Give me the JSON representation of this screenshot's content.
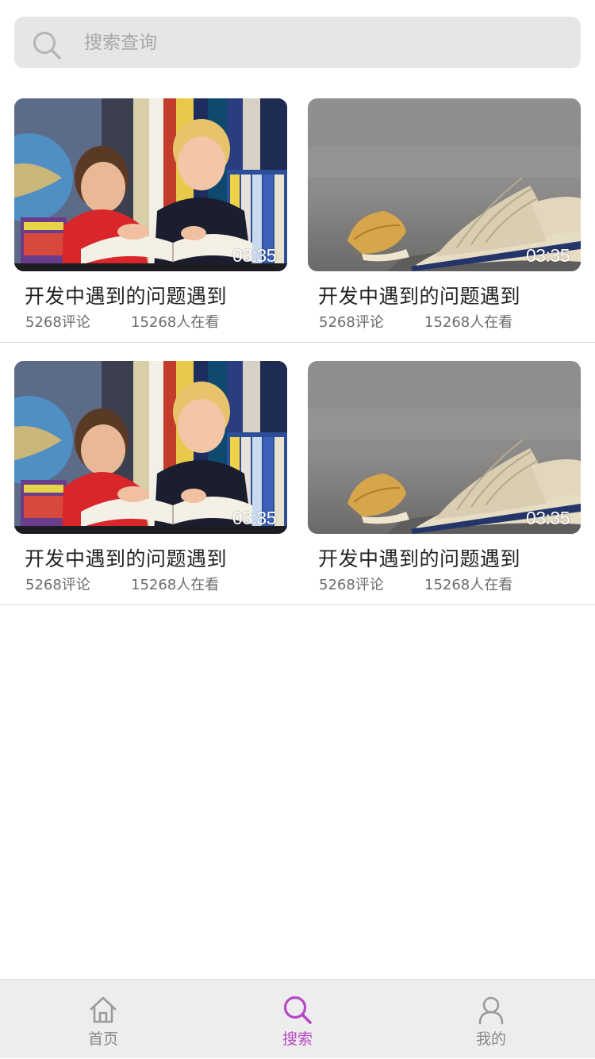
{
  "search": {
    "placeholder": "搜索查询",
    "icon": "search-icon"
  },
  "videos": [
    {
      "thumbnail": "boys-reading-books",
      "duration": "03:35",
      "title": "开发中遇到的问题遇到",
      "comments": "5268评论",
      "viewers": "15268人在看"
    },
    {
      "thumbnail": "open-book-with-leaf",
      "duration": "03:35",
      "title": "开发中遇到的问题遇到",
      "comments": "5268评论",
      "viewers": "15268人在看"
    },
    {
      "thumbnail": "boys-reading-books",
      "duration": "03:35",
      "title": "开发中遇到的问题遇到",
      "comments": "5268评论",
      "viewers": "15268人在看"
    },
    {
      "thumbnail": "open-book-with-leaf",
      "duration": "03:35",
      "title": "开发中遇到的问题遇到",
      "comments": "5268评论",
      "viewers": "15268人在看"
    }
  ],
  "tabbar": {
    "items": [
      {
        "label": "首页",
        "icon": "home-icon",
        "active": false
      },
      {
        "label": "搜索",
        "icon": "search-icon",
        "active": true
      },
      {
        "label": "我的",
        "icon": "user-icon",
        "active": false
      }
    ]
  },
  "colors": {
    "accent": "#b847c7",
    "inactive": "#8a8a8a",
    "search_bg": "#e6e6e6",
    "tabbar_bg": "#ededed"
  }
}
